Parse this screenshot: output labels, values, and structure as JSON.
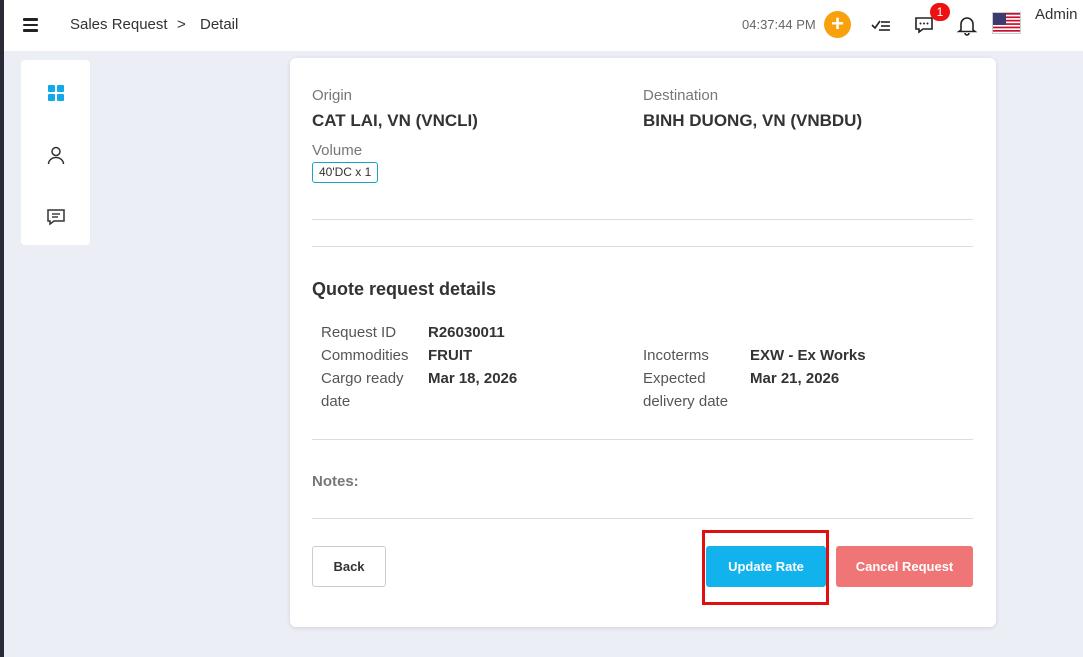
{
  "header": {
    "breadcrumb": [
      "Sales Request",
      ">",
      "Detail"
    ],
    "clock": "04:37:44 PM",
    "notification_count": "1",
    "user": "Admin",
    "icons": [
      "menu-icon",
      "plus-icon",
      "checklist-icon",
      "chat-icon",
      "bell-icon",
      "us-flag-icon"
    ]
  },
  "sidebar": {
    "items": [
      {
        "icon": "dashboard-icon",
        "active": true
      },
      {
        "icon": "user-icon",
        "active": false
      },
      {
        "icon": "message-icon",
        "active": false
      }
    ]
  },
  "route": {
    "origin_label": "Origin",
    "origin_value": "CAT LAI, VN (VNCLI)",
    "destination_label": "Destination",
    "destination_value": "BINH DUONG, VN (VNBDU)",
    "volume_label": "Volume",
    "volume_value": "40'DC x 1"
  },
  "details": {
    "title": "Quote request details",
    "request_id_label": "Request ID",
    "request_id_value": "R26030011",
    "commodities_label": "Commodities",
    "commodities_value": "FRUIT",
    "cargo_ready_label_1": "Cargo ready",
    "cargo_ready_label_2": "date",
    "cargo_ready_value": "Mar 18, 2026",
    "incoterms_label": "Incoterms",
    "incoterms_value": "EXW - Ex Works",
    "expected_label_1": "Expected",
    "expected_label_2": "delivery date",
    "expected_value": "Mar 21, 2026",
    "notes_label": "Notes:"
  },
  "actions": {
    "back": "Back",
    "update": "Update Rate",
    "cancel": "Cancel Request"
  },
  "colors": {
    "accent": "#12b2ed",
    "danger": "#f07577",
    "orange": "#f7a10c",
    "highlight": "#e01010"
  }
}
